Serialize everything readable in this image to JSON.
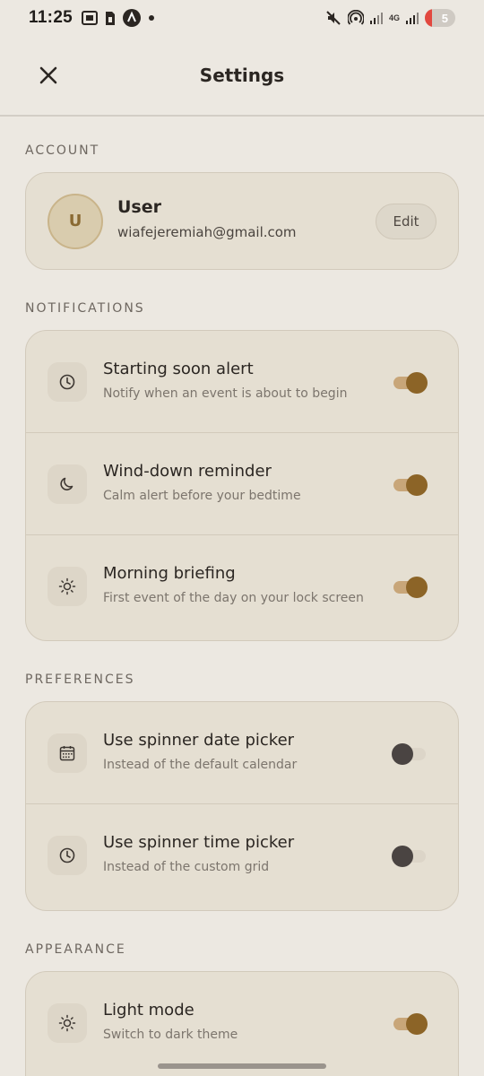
{
  "status_bar": {
    "time": "11:25",
    "network": "4G",
    "battery": "5",
    "icons": [
      "screenshot-icon",
      "sim-icon",
      "app-a-icon",
      "dot-icon",
      "mute-icon",
      "hotspot-icon",
      "signal-icon",
      "signal-icon"
    ]
  },
  "header": {
    "title": "Settings",
    "close_icon": "close-icon"
  },
  "account": {
    "section_label": "ACCOUNT",
    "avatar_initial": "U",
    "name": "User",
    "email": "wiafejeremiah@gmail.com",
    "edit_label": "Edit"
  },
  "notifications": {
    "section_label": "NOTIFICATIONS",
    "items": [
      {
        "icon": "clock-icon",
        "title": "Starting soon alert",
        "subtitle": "Notify when an event is about to begin",
        "enabled": true
      },
      {
        "icon": "moon-icon",
        "title": "Wind-down reminder",
        "subtitle": "Calm alert before your bedtime",
        "enabled": true
      },
      {
        "icon": "sun-icon",
        "title": "Morning briefing",
        "subtitle": "First event of the day on your lock screen",
        "enabled": true
      }
    ]
  },
  "preferences": {
    "section_label": "PREFERENCES",
    "items": [
      {
        "icon": "calendar-icon",
        "title": "Use spinner date picker",
        "subtitle": "Instead of the default calendar",
        "enabled": false
      },
      {
        "icon": "clock-icon",
        "title": "Use spinner time picker",
        "subtitle": "Instead of the custom grid",
        "enabled": false
      }
    ]
  },
  "appearance": {
    "section_label": "APPEARANCE",
    "items": [
      {
        "icon": "sun-icon",
        "title": "Light mode",
        "subtitle": "Switch to dark theme",
        "enabled": true
      }
    ]
  },
  "colors": {
    "background": "#ece8e1",
    "card": "#e5dfd2",
    "accent": "#8c6427",
    "toggle_off_thumb": "#4a4442"
  }
}
